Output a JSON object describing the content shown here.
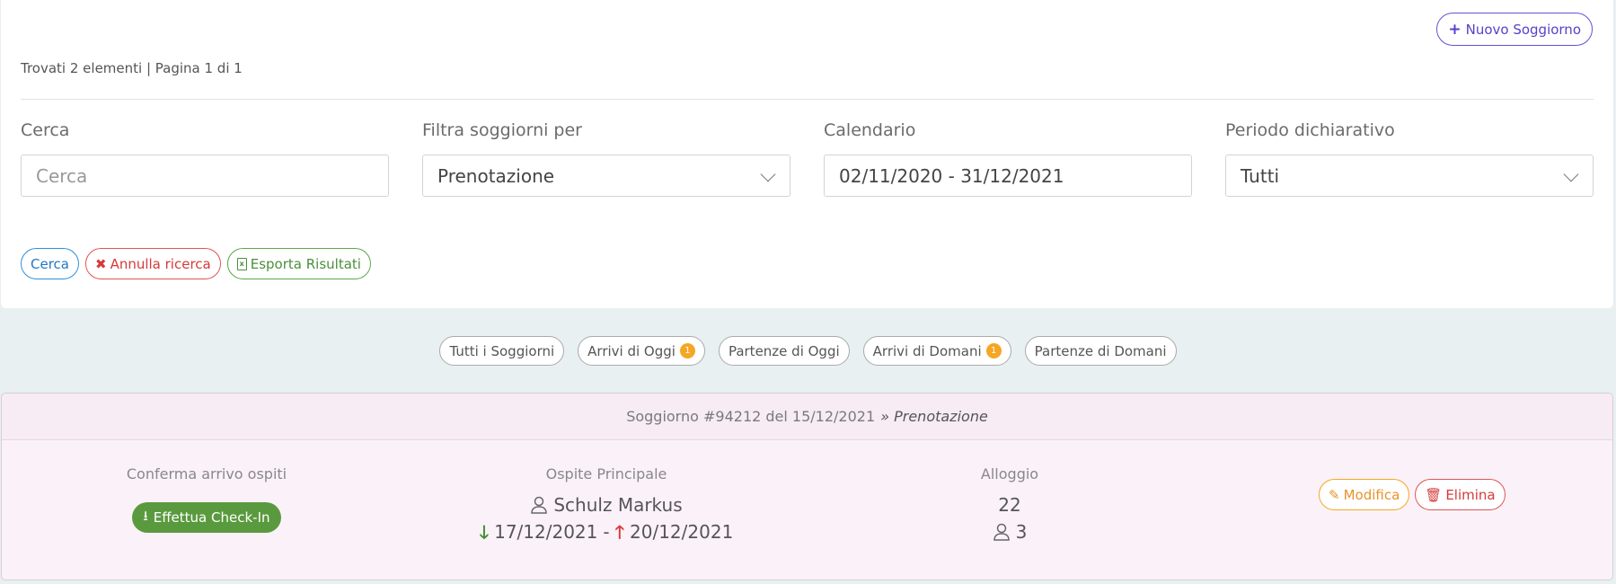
{
  "header": {
    "new_stay_label": "Nuovo Soggiorno",
    "found_text": "Trovati 2 elementi | Pagina 1 di 1"
  },
  "search": {
    "cerca_label": "Cerca",
    "cerca_placeholder": "Cerca",
    "filter_label": "Filtra soggiorni per",
    "filter_value": "Prenotazione",
    "calendar_label": "Calendario",
    "calendar_value": "02/11/2020 - 31/12/2021",
    "period_label": "Periodo dichiarativo",
    "period_value": "Tutti"
  },
  "actions": {
    "search": "Cerca",
    "cancel": "Annulla ricerca",
    "export": "Esporta Risultati"
  },
  "filters": [
    {
      "label": "Tutti i Soggiorni",
      "badge": null
    },
    {
      "label": "Arrivi di Oggi",
      "badge": "1"
    },
    {
      "label": "Partenze di Oggi",
      "badge": null
    },
    {
      "label": "Arrivi di Domani",
      "badge": "1"
    },
    {
      "label": "Partenze di Domani",
      "badge": null
    }
  ],
  "stay": {
    "title": "Soggiorno #94212 del 15/12/2021",
    "type": "» Prenotazione",
    "confirm_label": "Conferma arrivo ospiti",
    "checkin_label": "Effettua Check-In",
    "guest_label": "Ospite Principale",
    "guest_name": "Schulz Markus",
    "arrival": "17/12/2021",
    "departure": "20/12/2021",
    "dash": "-",
    "lodging_label": "Alloggio",
    "lodging_value": "22",
    "guests_count": "3",
    "edit_label": "Modifica",
    "delete_label": "Elimina"
  },
  "colors": {
    "accent": "#5a3fc9",
    "checkin": "#5a9a3e",
    "badge": "#f5a623"
  }
}
